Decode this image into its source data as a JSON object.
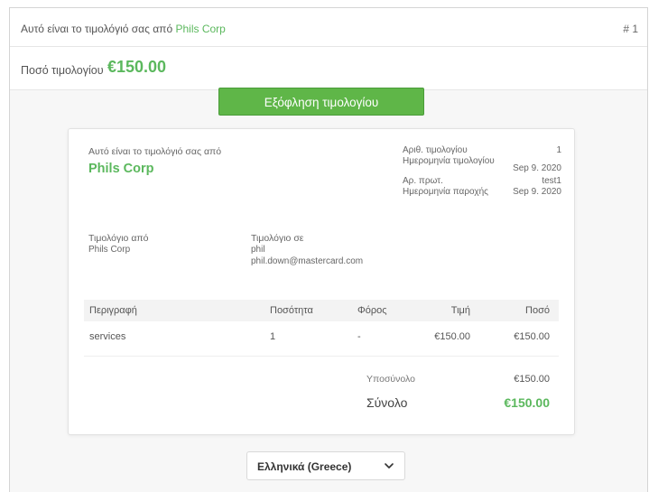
{
  "header": {
    "title_prefix": "Αυτό είναι το τιμολόγιό σας από ",
    "company": "Phils Corp",
    "invoice_number": "# 1"
  },
  "amount": {
    "label": "Ποσό τιμολογίου",
    "value": "€150.00"
  },
  "pay_button": "Εξόφληση τιμολογίου",
  "invoice": {
    "intro": "Αυτό είναι το τιμολόγιό σας από",
    "company": "Phils Corp",
    "meta": {
      "number_label": "Αριθ. τιμολογίου",
      "number_value": "1",
      "date_label": "Ημερομηνία τιμολογίου",
      "date_value": "Sep 9. 2020",
      "po_label": "Αρ. πρωτ.",
      "po_value": "test1",
      "supply_label": "Ημερομηνία παροχής",
      "supply_value": "Sep 9. 2020"
    },
    "from": {
      "heading": "Τιμολόγιο από",
      "name": "Phils Corp"
    },
    "to": {
      "heading": "Τιμολόγιο σε",
      "name": "phil",
      "email": "phil.down@mastercard.com"
    },
    "table": {
      "headers": [
        "Περιγραφή",
        "Ποσότητα",
        "Φόρος",
        "Τιμή",
        "Ποσό"
      ],
      "rows": [
        [
          "services",
          "1",
          "-",
          "€150.00",
          "€150.00"
        ]
      ]
    },
    "subtotal_label": "Υποσύνολο",
    "subtotal_value": "€150.00",
    "total_label": "Σύνολο",
    "total_value": "€150.00"
  },
  "language": {
    "selected": "Ελληνικά (Greece)",
    "icon": "chevron-down-icon"
  },
  "colors": {
    "accent": "#5bb85d",
    "button": "#5fb648"
  }
}
